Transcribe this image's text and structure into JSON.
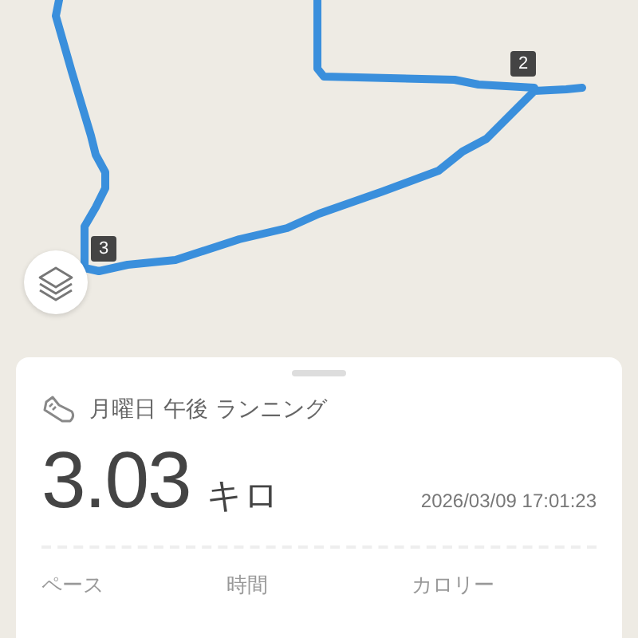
{
  "map": {
    "markers": [
      {
        "label": "2"
      },
      {
        "label": "3"
      }
    ]
  },
  "activity": {
    "title": "月曜日 午後 ランニング",
    "distance": "3.03",
    "unit": "キロ",
    "datetime": "2026/03/09 17:01:23"
  },
  "stats": [
    {
      "label": "ペース"
    },
    {
      "label": "時間"
    },
    {
      "label": "カロリー"
    }
  ]
}
